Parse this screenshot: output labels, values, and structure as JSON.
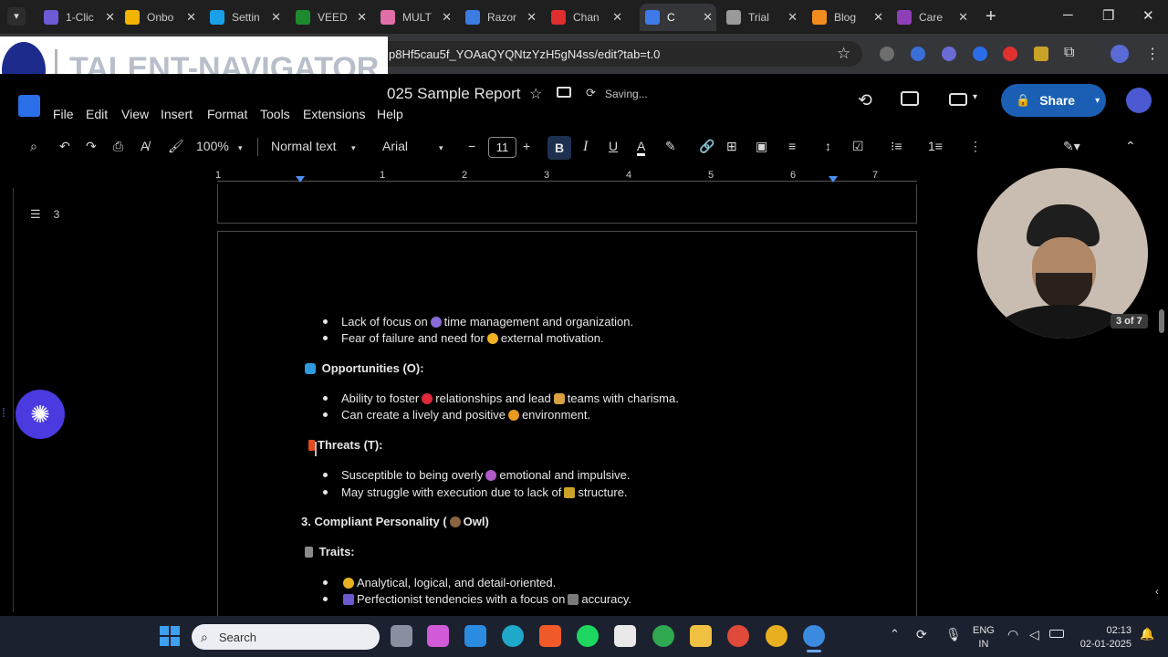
{
  "browser": {
    "tabs": [
      {
        "label": "1-Clic",
        "color": "#6b5bd6"
      },
      {
        "label": "Onbo",
        "color": "#f2b400"
      },
      {
        "label": "Settin",
        "color": "#1aa0e6"
      },
      {
        "label": "VEED",
        "color": "#1e8a2e"
      },
      {
        "label": "MULT",
        "color": "#e06fa8"
      },
      {
        "label": "Razor",
        "color": "#3c7be0"
      },
      {
        "label": "Chan",
        "color": "#e02d2d"
      },
      {
        "label": "C",
        "color": "#3f7be8"
      },
      {
        "label": "Trial",
        "color": "#9a9a9a"
      },
      {
        "label": "Blog",
        "color": "#f28b1e"
      },
      {
        "label": "Care",
        "color": "#8e3fb7"
      }
    ],
    "new_tab": "+",
    "url": "p8Hf5cau5f_YOAaQYQNtzYzH5gN4ss/edit?tab=t.0",
    "watermark": "TALENT-NAVIGATOR"
  },
  "docs": {
    "title": "025 Sample Report",
    "status": "Saving...",
    "share_label": "Share",
    "menu": [
      "File",
      "Edit",
      "View",
      "Insert",
      "Format",
      "Tools",
      "Extensions",
      "Help"
    ],
    "toolbar": {
      "zoom": "100%",
      "style": "Normal text",
      "font": "Arial",
      "font_size": "11"
    },
    "ruler": [
      "1",
      "1",
      "2",
      "3",
      "4",
      "5",
      "6",
      "7"
    ],
    "outline_count": "3",
    "page_indicator": "3 of 7"
  },
  "content": {
    "weakness_1": "Lack of focus on",
    "weakness_1b": "time management and organization.",
    "weakness_2": "Fear of failure and need for",
    "weakness_2b": "external motivation.",
    "opportunities_heading": "Opportunities (O):",
    "opp_1": "Ability to foster",
    "opp_1b": "relationships and lead",
    "opp_1c": "teams with charisma.",
    "opp_2": "Can create a lively and positive",
    "opp_2b": "environment.",
    "threats_heading": "Threats (T):",
    "threat_1": "Susceptible to being overly",
    "threat_1b": "emotional and impulsive.",
    "threat_2": "May struggle with execution due to lack of",
    "threat_2b": "structure.",
    "section_heading": "3. Compliant Personality (",
    "section_heading_b": "Owl)",
    "traits_heading": "Traits:",
    "trait_1": "Analytical, logical, and detail-oriented.",
    "trait_2": "Perfectionist tendencies with a focus on",
    "trait_2b": "accuracy."
  },
  "taskbar": {
    "search_placeholder": "Search",
    "lang_1": "ENG",
    "lang_2": "IN",
    "time": "02:13",
    "date": "02-01-2025"
  }
}
